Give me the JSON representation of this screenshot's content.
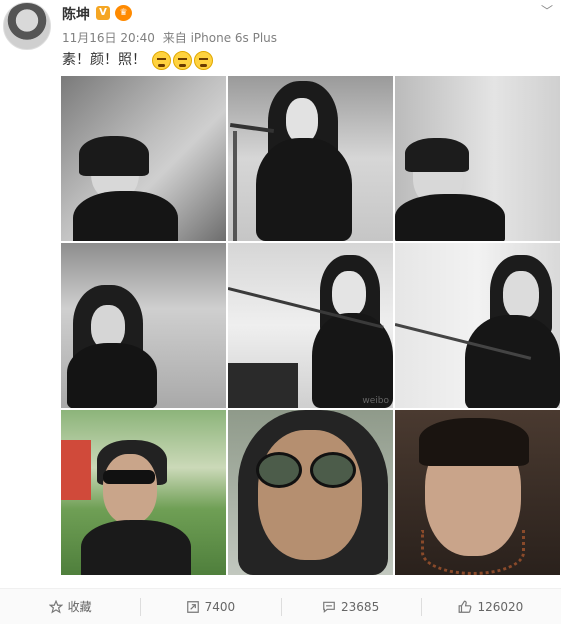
{
  "post": {
    "author": "陈坤",
    "badge": "V",
    "time": "11月16日 20:40",
    "via": "来自 iPhone 6s Plus",
    "text": "素！颜！照！"
  },
  "actions": {
    "collect": "收藏",
    "repost": "7400",
    "comment": "23685",
    "like": "126020"
  },
  "photos": {
    "watermark": "weibo",
    "count": 9
  },
  "colors": {
    "badge_v": "#f5a623",
    "member_badge": "#ff8a00",
    "meta_text": "#808080",
    "action_bar": "#fafafa"
  }
}
